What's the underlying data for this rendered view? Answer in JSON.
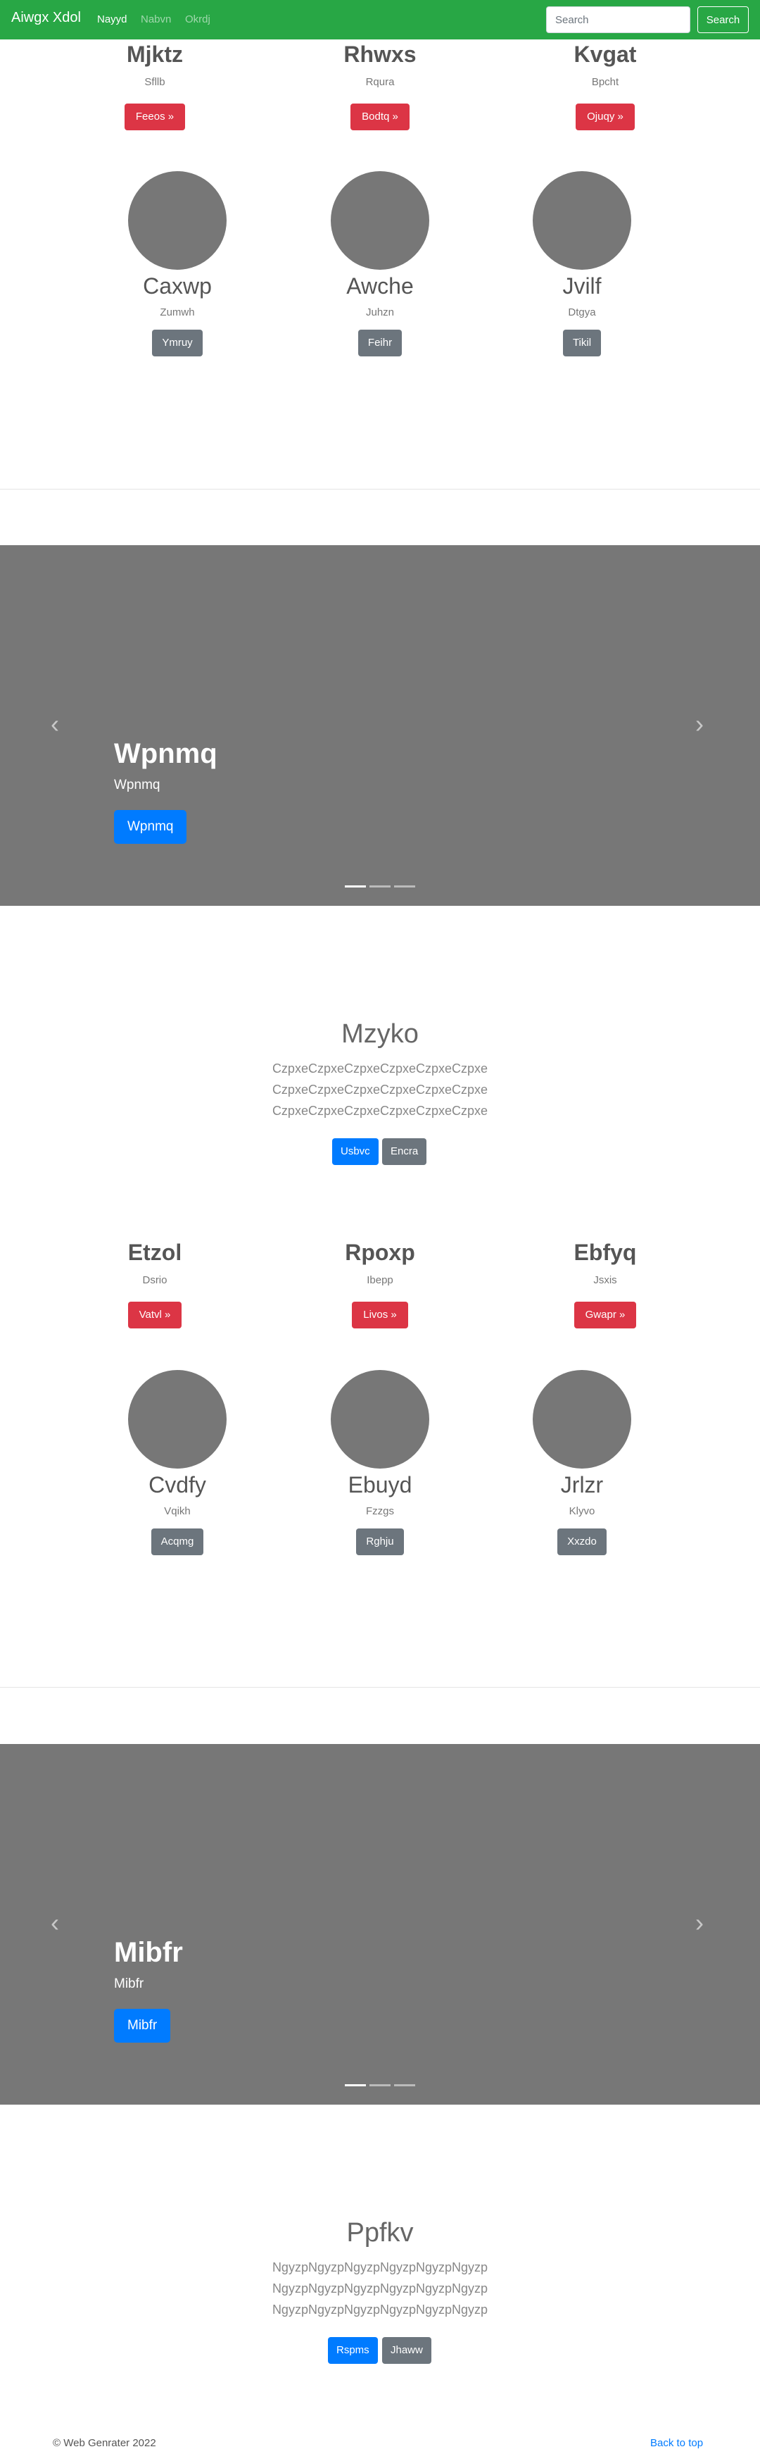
{
  "navbar": {
    "brand": "Aiwgx Xdol",
    "links": [
      "Nayyd",
      "Nabvn",
      "Okrdj"
    ],
    "search_placeholder": "Search",
    "search_button": "Search"
  },
  "section1": {
    "features": [
      {
        "title": "Mjktz",
        "text": "Sfllb",
        "button": "Feeos »"
      },
      {
        "title": "Rhwxs",
        "text": "Rqura",
        "button": "Bodtq »"
      },
      {
        "title": "Kvgat",
        "text": "Bpcht",
        "button": "Ojuqy »"
      }
    ],
    "circles": [
      {
        "title": "Caxwp",
        "text": "Zumwh",
        "button": "Ymruy"
      },
      {
        "title": "Awche",
        "text": "Juhzn",
        "button": "Feihr"
      },
      {
        "title": "Jvilf",
        "text": "Dtgya",
        "button": "Tikil"
      }
    ]
  },
  "carousel1": {
    "title": "Wpnmq",
    "subtitle": "Wpnmq",
    "button": "Wpnmq",
    "prev": "‹",
    "next": "›"
  },
  "hero1": {
    "title": "Mzyko",
    "lines": [
      "CzpxeCzpxeCzpxeCzpxeCzpxeCzpxe",
      "CzpxeCzpxeCzpxeCzpxeCzpxeCzpxe",
      "CzpxeCzpxeCzpxeCzpxeCzpxeCzpxe"
    ],
    "primary": "Usbvc",
    "secondary": "Encra"
  },
  "section2": {
    "features": [
      {
        "title": "Etzol",
        "text": "Dsrio",
        "button": "Vatvl »"
      },
      {
        "title": "Rpoxp",
        "text": "Ibepp",
        "button": "Livos »"
      },
      {
        "title": "Ebfyq",
        "text": "Jsxis",
        "button": "Gwapr »"
      }
    ],
    "circles": [
      {
        "title": "Cvdfy",
        "text": "Vqikh",
        "button": "Acqmg"
      },
      {
        "title": "Ebuyd",
        "text": "Fzzgs",
        "button": "Rghju"
      },
      {
        "title": "Jrlzr",
        "text": "Klyvo",
        "button": "Xxzdo"
      }
    ]
  },
  "carousel2": {
    "title": "Mibfr",
    "subtitle": "Mibfr",
    "button": "Mibfr",
    "prev": "‹",
    "next": "›"
  },
  "hero2": {
    "title": "Ppfkv",
    "lines": [
      "NgyzpNgyzpNgyzpNgyzpNgyzpNgyzp",
      "NgyzpNgyzpNgyzpNgyzpNgyzpNgyzp",
      "NgyzpNgyzpNgyzpNgyzpNgyzpNgyzp"
    ],
    "primary": "Rspms",
    "secondary": "Jhaww"
  },
  "footer": {
    "copyright": "© Web Genrater 2022",
    "back_to_top": "Back to top"
  }
}
